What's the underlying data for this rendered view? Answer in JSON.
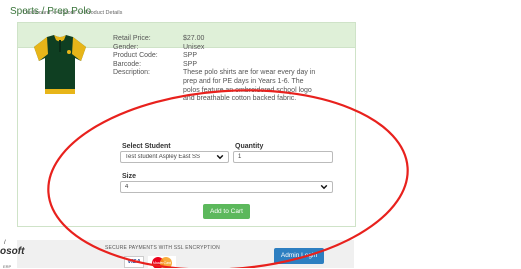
{
  "breadcrumb": "Dashboard >> eStore >> Product Details",
  "product": {
    "title": "Sports / Prep Polo",
    "image_alt": "Green and gold polo shirt",
    "details": [
      {
        "label": "Retail Price:",
        "value": "$27.00"
      },
      {
        "label": "Gender:",
        "value": "Unisex"
      },
      {
        "label": "Product Code:",
        "value": "SPP"
      },
      {
        "label": "Barcode:",
        "value": "SPP"
      },
      {
        "label": "Description:",
        "value": "These polo shirts are for wear every day in prep and for PE days in Years 1-6.   The polos feature an embroidered school logo and breathable cotton backed fabric."
      }
    ]
  },
  "form": {
    "student_label": "Select Student",
    "student_value": "Test student Aspley East SS",
    "quantity_label": "Quantity",
    "quantity_value": "1",
    "size_label": "Size",
    "size_value": "4",
    "add_to_cart": "Add to Cart"
  },
  "footer": {
    "secure_text": "SECURE PAYMENTS WITH SSL ENCRYPTION",
    "visa": "VISA",
    "mastercard": "MasterCard",
    "admin_login": "Admin Login",
    "ms_logo": "osoft",
    "ms_sub": "ERP",
    "ms_mark": "/"
  },
  "colors": {
    "panel_header_bg": "#dff0d8",
    "title_green": "#3c763d",
    "add_button": "#5cb85c",
    "admin_button": "#2d7fc1",
    "annotation_red": "#e8211d"
  },
  "icons": [
    "polo-shirt-image",
    "chevron-down-icon",
    "visa-logo",
    "mastercard-logo"
  ]
}
